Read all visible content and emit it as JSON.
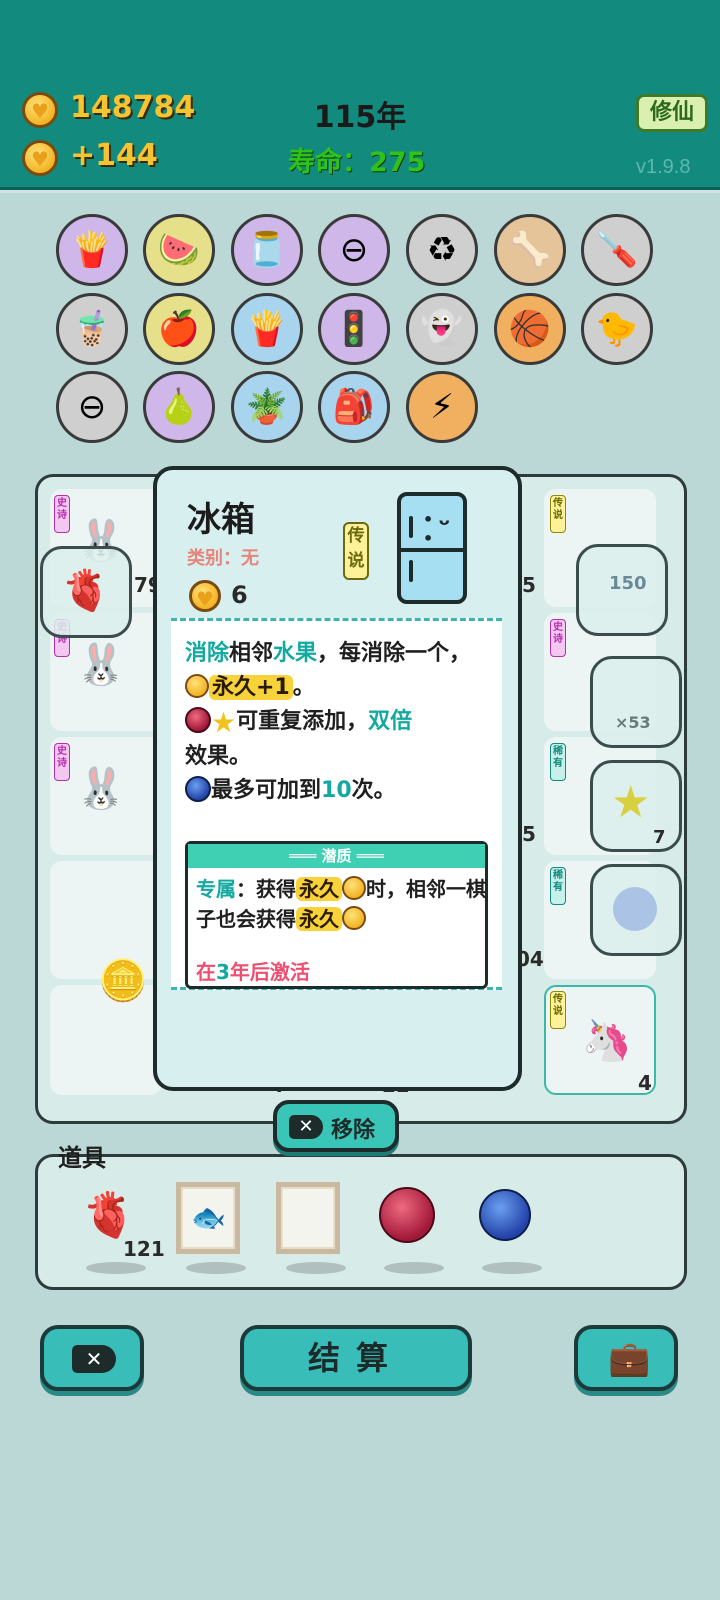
{
  "header": {
    "coins": "148784",
    "income": "+144",
    "year": "115年",
    "lifespan": "寿命：275",
    "cultivate_label": "修仙",
    "version": "v1.9.8"
  },
  "inventory": {
    "icons": [
      "fries-icon",
      "fruit-basket-icon",
      "jar-icon",
      "minus-icon",
      "recycle-icon",
      "pet-bowl-icon",
      "screwdriver-icon",
      "bubble-tea-icon",
      "fruit-basket-icon",
      "fries-icon",
      "traffic-light-icon",
      "ghost-icon",
      "basketballs-icon",
      "chick-icon",
      "minus-icon",
      "pear-icon",
      "flower-pot-icon",
      "seed-bag-icon",
      "lightning-icon"
    ]
  },
  "board": {
    "tags": {
      "epic": "史诗",
      "legendary": "传说",
      "rare": "稀有"
    },
    "counts": [
      "79",
      "5",
      "5",
      "04",
      "4",
      "22",
      "4"
    ],
    "bubble_counts": [
      "150",
      "×53",
      "7"
    ]
  },
  "card": {
    "title": "冰箱",
    "category": "类别：无",
    "rarity": "传说",
    "cost": "6",
    "desc": {
      "l1_a": "消除",
      "l1_b": "相邻",
      "l1_c": "水果",
      "l1_d": "，每消除一个，",
      "l1_e": "永久+1",
      "l1_f": "。",
      "l2_a": "可重复添加，",
      "l2_b": "双倍",
      "l2_c": "效果。",
      "l3_a": "最多可加到",
      "l3_b": "10",
      "l3_c": "次。"
    },
    "potential": {
      "header": "潜质",
      "label": "专属",
      "text_a": "：获得",
      "gold1": "永久",
      "text_b": "时，相邻一棋子也会获得",
      "gold2": "永久",
      "activate_a": "在",
      "activate_b": "3",
      "activate_c": "年后激活"
    }
  },
  "remove_label": "移除",
  "tools": {
    "title": "道具",
    "liver_count": "121"
  },
  "bottom": {
    "settle_label": "结算"
  }
}
